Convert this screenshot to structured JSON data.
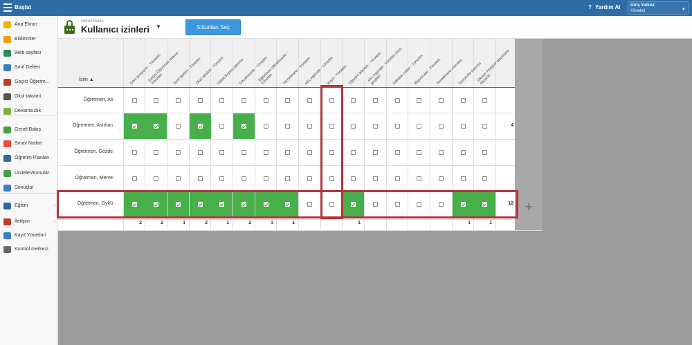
{
  "topbar": {
    "start_label": "Başlat",
    "help_label": "Yardım Al",
    "help_icon": "?",
    "auth_title": "Giriş Yetkisi:",
    "auth_value": "Yönetici"
  },
  "sidebar": {
    "items": [
      {
        "label": "Ana Ekran",
        "icon": "star-icon",
        "color": "#f0b400"
      },
      {
        "label": "Bildirimler",
        "icon": "mail-icon",
        "color": "#f39c12"
      },
      {
        "label": "Web sayfası",
        "icon": "home-icon",
        "color": "#2e8b57"
      },
      {
        "label": "Sınıf Defteri",
        "icon": "notebook-icon",
        "color": "#3a7fc1"
      },
      {
        "label": "Geçici Öğretm...",
        "icon": "user-icon",
        "color": "#c0392b"
      },
      {
        "label": "Okul takvimi",
        "icon": "calendar-icon",
        "color": "#555555"
      },
      {
        "label": "Devamsızlık",
        "icon": "person-icon",
        "color": "#7cb342"
      },
      {
        "label": "Genel Bakış",
        "icon": "check-circle-icon",
        "color": "#43a047"
      },
      {
        "label": "Sınav Notları",
        "icon": "exam-icon",
        "color": "#e74c3c"
      },
      {
        "label": "Öğretim Planları",
        "icon": "plan-icon",
        "color": "#2c6aa0"
      },
      {
        "label": "Üniteler/Konular",
        "icon": "shield-check-icon",
        "color": "#43a047"
      },
      {
        "label": "Sonuçlar",
        "icon": "bar-chart-icon",
        "color": "#3a7fc1"
      },
      {
        "label": "Eğitim",
        "icon": "education-icon",
        "color": "#2c6aa0"
      },
      {
        "label": "İletişim",
        "icon": "chat-icon",
        "color": "#c0392b"
      },
      {
        "label": "Kayıt Yönetimi",
        "icon": "pen-icon",
        "color": "#3a7fc1"
      },
      {
        "label": "Kontrol merkezi",
        "icon": "gear-icon",
        "color": "#666666"
      }
    ]
  },
  "header": {
    "subtitle": "Genel Bakış",
    "title": "Kullanıcı izinleri",
    "dropdown_icon": "▼",
    "select_columns_label": "Sütunları Seç"
  },
  "grid": {
    "name_header": "İsim ▲",
    "columns": [
      "Ders programı - Yönetim",
      "Geçici Öğretmen Atama - Yönetim",
      "Sınıf defteri - Yönetim",
      "Okul takvimi - Yönetim",
      "Dijital duyuru panosu",
      "Devamsızlık - Yönetim",
      "Öğretmen devamsızlık - Yönetim",
      "Yemekhane - Yönetim",
      "eSc Agenda - Yönetim",
      "Kayıt - Yönetim",
      "Öğretim planları - Yönetim",
      "eSc Agenda - Yönetim (tüm gruplar)",
      "Haftalık notlar - Yönetim",
      "Başvurular - Yönetim",
      "Yemekhane menüsü",
      "Duyurular panosu",
      "Okulun fotoğraf albümünü düzenle"
    ],
    "rows": [
      {
        "name": "Öğretmen, Ali",
        "checks": [
          0,
          0,
          0,
          0,
          0,
          0,
          0,
          0,
          0,
          0,
          0,
          0,
          0,
          0,
          0,
          0,
          0
        ],
        "total": ""
      },
      {
        "name": "Öğretmen, Aslıhan",
        "checks": [
          1,
          1,
          0,
          1,
          0,
          1,
          0,
          0,
          0,
          0,
          0,
          0,
          0,
          0,
          0,
          0,
          0
        ],
        "total": "4"
      },
      {
        "name": "Öğretmen, Gözde",
        "checks": [
          0,
          0,
          0,
          0,
          0,
          0,
          0,
          0,
          0,
          0,
          0,
          0,
          0,
          0,
          0,
          0,
          0
        ],
        "total": ""
      },
      {
        "name": "Öğretmen, Merve",
        "checks": [
          0,
          0,
          0,
          0,
          0,
          0,
          0,
          0,
          0,
          0,
          0,
          0,
          0,
          0,
          0,
          0,
          0
        ],
        "total": ""
      },
      {
        "name": "Öğretmen, Öykü",
        "checks": [
          1,
          1,
          1,
          1,
          1,
          1,
          1,
          1,
          0,
          0,
          1,
          0,
          0,
          0,
          0,
          1,
          1
        ],
        "total": "12"
      }
    ],
    "column_totals": [
      "2",
      "2",
      "1",
      "2",
      "1",
      "2",
      "1",
      "1",
      "",
      "",
      "1",
      "",
      "",
      "",
      "",
      "1",
      "1"
    ],
    "add_icon": "+"
  }
}
